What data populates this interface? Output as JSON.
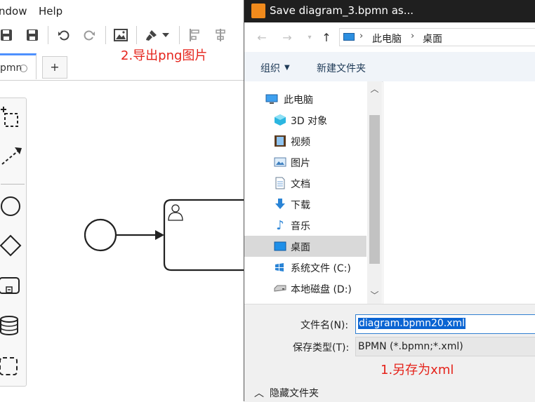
{
  "app": {
    "menu": {
      "window": "ndow",
      "help": "Help"
    },
    "annotation_export": "2.导出png图片",
    "tab": {
      "label": "pmn",
      "add": "+"
    }
  },
  "dialog": {
    "title": "Save diagram_3.bpmn as...",
    "breadcrumb": [
      "此电脑",
      "桌面"
    ],
    "commands": {
      "organize": "组织",
      "new_folder": "新建文件夹"
    },
    "nav_items": [
      {
        "label": "此电脑",
        "icon": "computer-icon"
      },
      {
        "label": "3D 对象",
        "icon": "3d-objects-icon"
      },
      {
        "label": "视频",
        "icon": "video-icon"
      },
      {
        "label": "图片",
        "icon": "pictures-icon"
      },
      {
        "label": "文档",
        "icon": "documents-icon"
      },
      {
        "label": "下载",
        "icon": "download-icon"
      },
      {
        "label": "音乐",
        "icon": "music-icon"
      },
      {
        "label": "桌面",
        "icon": "desktop-icon",
        "selected": true
      },
      {
        "label": "系统文件 (C:)",
        "icon": "system-drive-icon"
      },
      {
        "label": "本地磁盘 (D:)",
        "icon": "local-disk-icon"
      }
    ],
    "filename_label": "文件名(N):",
    "filename_value": "diagram.bpmn20.xml",
    "filetype_label": "保存类型(T):",
    "filetype_value": "BPMN (*.bpmn;*.xml)",
    "annotation_save": "1.另存为xml",
    "hide_folders": "隐藏文件夹"
  },
  "colors": {
    "accent": "#4d90fe",
    "annotation": "#e5231b",
    "titlebar": "#1f1f1f",
    "selection": "#0a64d2"
  }
}
